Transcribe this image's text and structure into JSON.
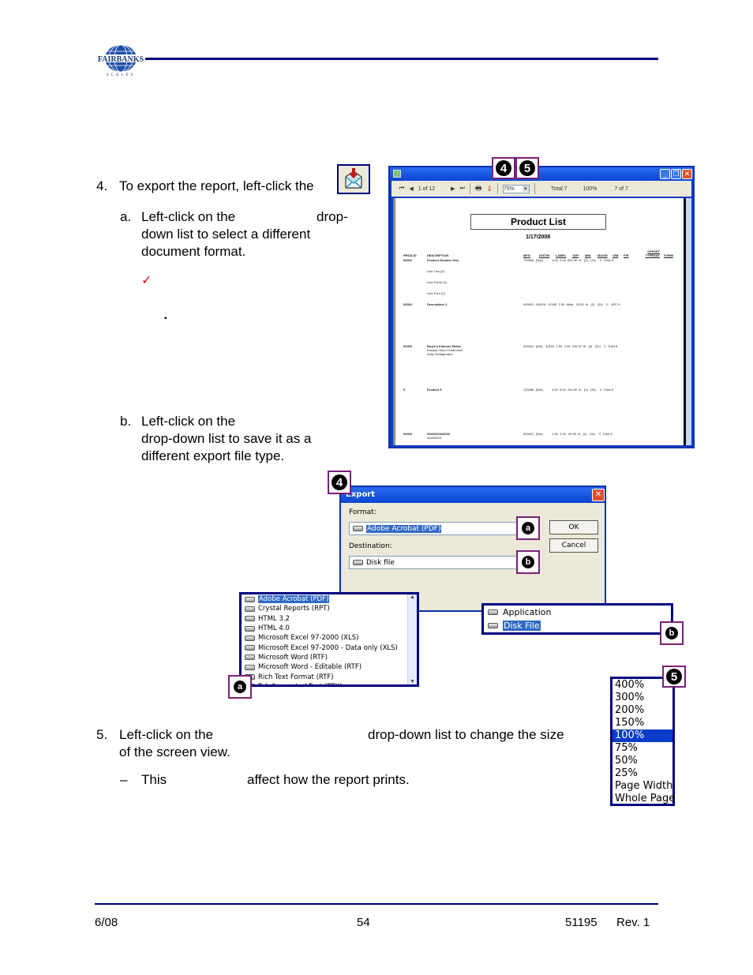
{
  "header": {
    "logo_text": "FAIRBANKS",
    "logo_subtext": "SCALES",
    "accent_color": "#000080"
  },
  "step4": {
    "number": "4.",
    "text": "To export the report, left-click the",
    "icon": "export-envelope-icon",
    "sub_a": {
      "letter": "a.",
      "line1": "Left-click on the",
      "line1_end": "drop-",
      "line2": "down list to select a different",
      "line3": "document format."
    },
    "checkmark": "✓",
    "bullet": "▪",
    "sub_b": {
      "letter": "b.",
      "line1": "Left-click on the",
      "line2": "drop-down list to save it as a",
      "line3": "different export file type."
    }
  },
  "callouts": {
    "four": "4",
    "five": "5",
    "a": "a",
    "b": "b"
  },
  "viewer": {
    "toolbar": {
      "first": "⏮",
      "prev": "◀",
      "page_indicator": "1 of 12",
      "next": "▶",
      "last": "⏭",
      "zoom_value": "75%",
      "total": "Total:7",
      "percent": "100%",
      "count": "7 of 7"
    },
    "report": {
      "title": "Product List",
      "date": "1/17/2008",
      "columns": [
        "PROD.ID",
        "DESCRIPTION",
        "MFG",
        "DISTRI",
        "LABEL",
        "TAR",
        "MIN",
        "MAXW",
        "U/M",
        "F/R",
        "OFFSET TYPEDAY",
        "FORM"
      ],
      "rows": [
        {
          "id": "00001",
          "desc": "Product Number One",
          "extra": [
            "Line Two (3)",
            "Line Three (3)",
            "Line Four (2)"
          ],
          "values": "730656  (N/A)          1.00  0.00  500.00  lb   (0)   (31)    0   EAN 8"
        },
        {
          "id": "00002",
          "desc": "Description 2",
          "extra": [],
          "values": "000001  000001  12345  2.00  ####   20.00  lb   (0)   (31)    0   UPC 8"
        },
        {
          "id": "00300",
          "desc": "Boyle's Famous Meats",
          "extra": [
            "Kansas City's Finest beef",
            "Keep Refrigerated"
          ],
          "values": "000001  (N/A)   10100  1.00  2.00  100.00  lb   (0)   (31)    0   EAN 8"
        },
        {
          "id": "5",
          "desc": "Product 5",
          "extra": [],
          "values": "123456  (N/A)          2.00  0.00  100.00  lb   (0)   (31)    0   EAN 8"
        },
        {
          "id": "00003",
          "desc": "3333333333333",
          "extra": [
            "33333333"
          ],
          "values": "000001  (N/A)          1.00  1.00   50.00  lb   (0)   (31)    0   EAN 8"
        }
      ]
    }
  },
  "export_dialog": {
    "title": "Export",
    "format_label": "Format:",
    "format_value": "Adobe Acrobat (PDF)",
    "destination_label": "Destination:",
    "destination_value": "Disk file",
    "ok_label": "OK",
    "cancel_label": "Cancel",
    "close": "✕"
  },
  "format_list": {
    "items": [
      "Adobe Acrobat (PDF)",
      "Crystal Reports (RPT)",
      "HTML 3.2",
      "HTML 4.0",
      "Microsoft Excel 97-2000 (XLS)",
      "Microsoft Excel 97-2000 - Data only (XLS)",
      "Microsoft Word (RTF)",
      "Microsoft Word - Editable (RTF)",
      "Rich Text Format (RTF)",
      "Tab-Separated Text (TTX)"
    ],
    "selected_index": 0
  },
  "destination_list": {
    "items": [
      "Application",
      "Disk File"
    ],
    "selected_index": 1
  },
  "zoom_list": {
    "items": [
      "400%",
      "300%",
      "200%",
      "150%",
      "100%",
      "75%",
      "50%",
      "25%",
      "Page Width",
      "Whole Page"
    ],
    "selected_index": 4
  },
  "step5": {
    "number": "5.",
    "line1_start": "Left-click on the",
    "line1_end": "drop-down list to change the size",
    "line2": "of the screen view.",
    "dash": "–",
    "note_start": "This",
    "note_end": "affect how the report prints."
  },
  "footer": {
    "date": "6/08",
    "page": "54",
    "doc_number": "51195",
    "revision": "Rev. 1"
  }
}
